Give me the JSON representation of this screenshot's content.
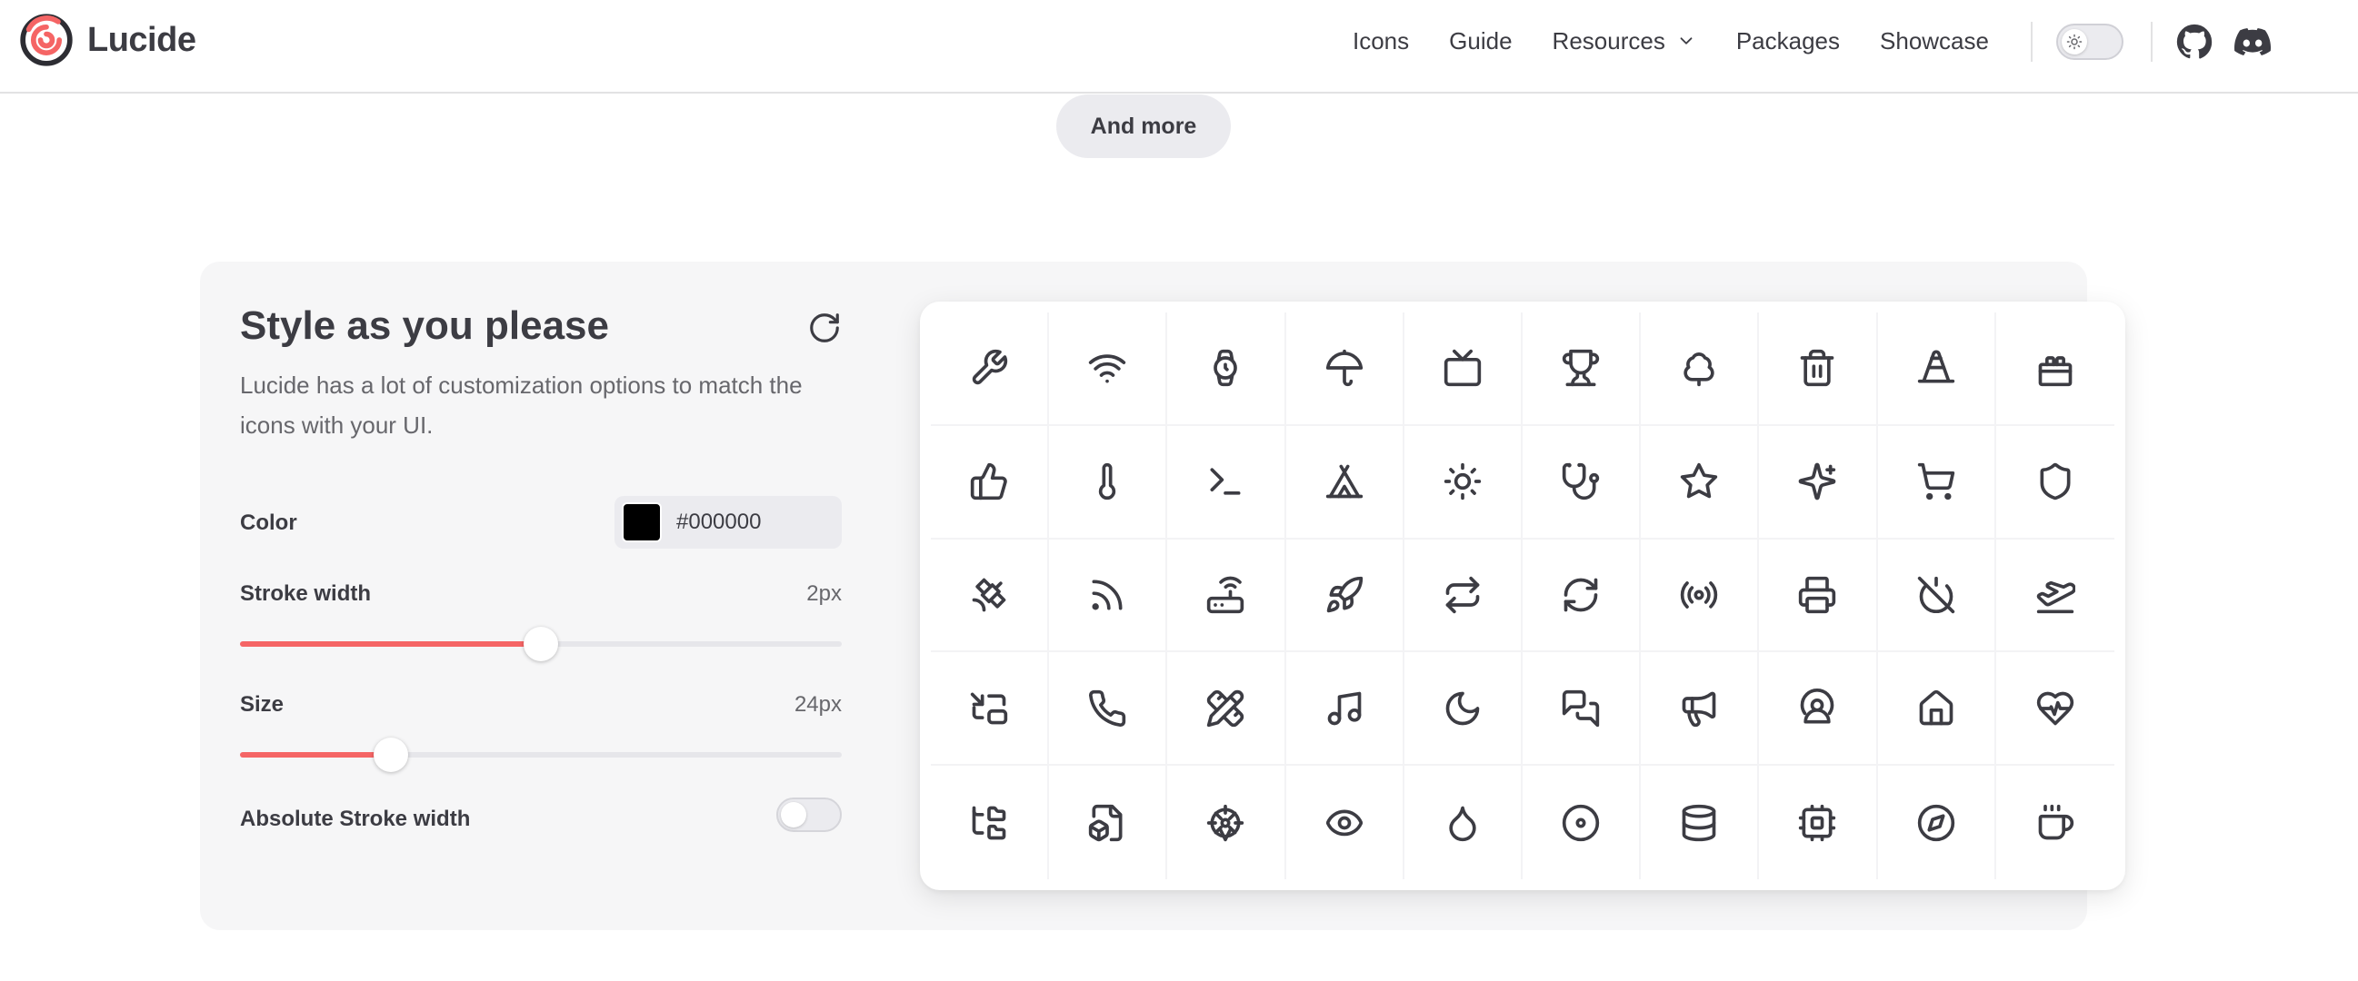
{
  "header": {
    "brand": "Lucide",
    "nav": [
      {
        "label": "Icons",
        "name": "nav-icons"
      },
      {
        "label": "Guide",
        "name": "nav-guide"
      },
      {
        "label": "Resources",
        "name": "nav-resources"
      },
      {
        "label": "Packages",
        "name": "nav-packages"
      },
      {
        "label": "Showcase",
        "name": "nav-showcase"
      }
    ]
  },
  "and_more": "And more",
  "customizer": {
    "title": "Style as you please",
    "description": "Lucide has a lot of customization options to match the icons with your UI.",
    "color": {
      "label": "Color",
      "value": "#000000"
    },
    "stroke_width": {
      "label": "Stroke width",
      "value": "2px",
      "fraction": 0.5
    },
    "size": {
      "label": "Size",
      "value": "24px",
      "fraction": 0.25
    },
    "absolute_stroke": {
      "label": "Absolute Stroke width",
      "enabled": false
    }
  },
  "colors": {
    "accent": "#f56565",
    "text": "#3c3c43",
    "muted": "#67676c",
    "panel": "#f6f6f7"
  },
  "icons": [
    "wrench-icon",
    "wifi-icon",
    "watch-icon",
    "umbrella-icon",
    "tv-icon",
    "trophy-icon",
    "tree-icon",
    "trash-icon",
    "traffic-cone-icon",
    "toy-brick-icon",
    "thumbs-up-icon",
    "thermometer-icon",
    "terminal-icon",
    "tent-icon",
    "sun-icon",
    "stethoscope-icon",
    "star-icon",
    "sparkles-icon",
    "shopping-cart-icon",
    "shield-icon",
    "satellite-icon",
    "rss-icon",
    "router-icon",
    "rocket-icon",
    "repeat-icon",
    "refresh-icon",
    "radio-icon",
    "printer-icon",
    "power-off-icon",
    "plane-takeoff-icon",
    "picture-in-picture-icon",
    "phone-icon",
    "pencil-ruler-icon",
    "music-icon",
    "moon-icon",
    "messages-square-icon",
    "megaphone-icon",
    "map-pin-user-icon",
    "home-icon",
    "heart-pulse-icon",
    "folder-tree-icon",
    "file-box-icon",
    "ferris-wheel-icon",
    "eye-icon",
    "droplet-icon",
    "disc-icon",
    "database-icon",
    "cpu-icon",
    "compass-icon",
    "coffee-icon"
  ]
}
